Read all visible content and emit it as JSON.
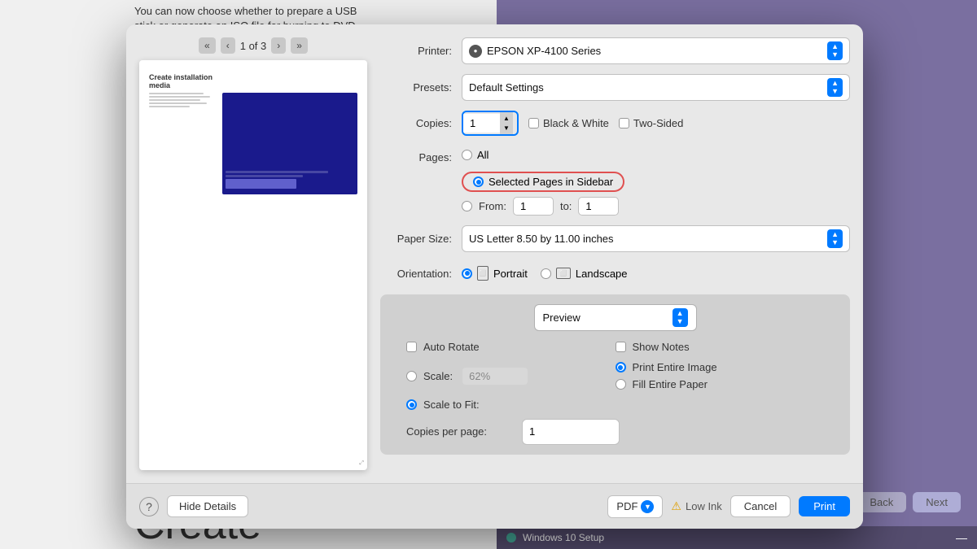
{
  "background": {
    "text_line1": "You can now choose whether to prepare a USB",
    "text_line2": "stick or generate an ISO file for burning to DVD",
    "create_label": "Create"
  },
  "taskbar": {
    "app_label": "Windows 10 Setup",
    "minimize_label": "—"
  },
  "nav_buttons": {
    "back_label": "Back",
    "next_label": "Next"
  },
  "dialog": {
    "printer": {
      "label": "Printer:",
      "value": "EPSON XP-4100 Series",
      "icon": "●"
    },
    "presets": {
      "label": "Presets:",
      "value": "Default Settings"
    },
    "copies": {
      "label": "Copies:",
      "value": "1",
      "black_white_label": "Black & White",
      "two_sided_label": "Two-Sided"
    },
    "pages": {
      "label": "Pages:",
      "all_label": "All",
      "selected_pages_label": "Selected Pages in Sidebar",
      "from_label": "From:",
      "from_value": "1",
      "to_label": "to:",
      "to_value": "1"
    },
    "paper_size": {
      "label": "Paper Size:",
      "value": "US Letter 8.50 by 11.00 inches"
    },
    "orientation": {
      "label": "Orientation:",
      "portrait_label": "Portrait",
      "landscape_label": "Landscape"
    },
    "preview_dropdown": {
      "value": "Preview"
    },
    "options": {
      "auto_rotate_label": "Auto Rotate",
      "show_notes_label": "Show Notes",
      "scale_label": "Scale:",
      "scale_value": "62%",
      "scale_to_fit_label": "Scale to Fit:",
      "print_entire_image_label": "Print Entire Image",
      "fill_entire_paper_label": "Fill Entire Paper",
      "copies_per_page_label": "Copies per page:",
      "copies_per_page_value": "1"
    },
    "footer": {
      "help_label": "?",
      "hide_details_label": "Hide Details",
      "pdf_label": "PDF",
      "low_ink_label": "Low Ink",
      "cancel_label": "Cancel",
      "print_label": "Print"
    },
    "page_nav": {
      "count": "1 of 3"
    }
  }
}
